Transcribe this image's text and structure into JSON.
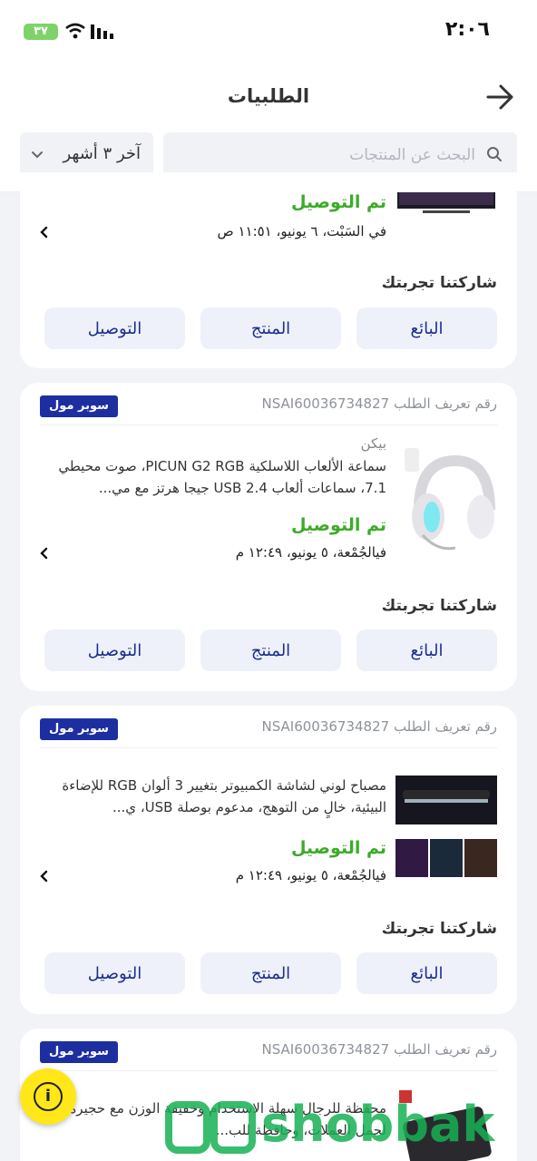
{
  "status_bar": {
    "time": "٢:٠٦",
    "battery": "٣٧"
  },
  "header": {
    "title": "الطلبيات"
  },
  "search": {
    "placeholder": "البحث عن المنتجات"
  },
  "filter": {
    "label": "آخر ٣ أشهر"
  },
  "top_card": {
    "delivered_label": "تم التوصيل",
    "date": "في السَبْت، ٦ يونيو، ١١:٥١ ص",
    "share_label": "شاركتنا تجربتك",
    "buttons": {
      "seller": "البائع",
      "product": "المنتج",
      "delivery": "التوصيل"
    }
  },
  "orders": [
    {
      "order_id": "رقم تعريف الطلب NSAI60036734827",
      "badge": "سوبر مول",
      "seller": "بيكن",
      "product_name": "سماعة الألعاب اللاسلكية PICUN G2 RGB، صوت محيطي 7.1، سماعات ألعاب USB 2.4 جيجا هرتز مع مي...",
      "delivered_label": "تم التوصيل",
      "date": "فيالجُمْعة، ٥ يونيو، ١٢:٤٩ م",
      "share_label": "شاركتنا تجربتك",
      "buttons": {
        "seller": "البائع",
        "product": "المنتج",
        "delivery": "التوصيل"
      }
    },
    {
      "order_id": "رقم تعريف الطلب NSAI60036734827",
      "badge": "سوبر مول",
      "product_name": "مصباح لوني لشاشة الكمبيوتر بتغيير 3 ألوان RGB للإضاءة البيئية، خالٍ من التوهج، مدعوم بوصلة USB، ي...",
      "delivered_label": "تم التوصيل",
      "date": "فيالجُمْعة، ٥ يونيو، ١٢:٤٩ م",
      "share_label": "شاركتنا تجربتك",
      "buttons": {
        "seller": "البائع",
        "product": "المنتج",
        "delivery": "التوصيل"
      }
    },
    {
      "order_id": "رقم تعريف الطلب NSAI60036734827",
      "badge": "سوبر مول",
      "product_name": "محفظة للرجال سهلة الاستخدام وخفيفة الوزن مع حجيرة لحمل العملات، وحافظة للب..."
    }
  ],
  "watermark": {
    "text": "shobbak"
  },
  "colors": {
    "delivered": "#3dab2a",
    "button_text": "#1d2e8e",
    "badge_bg": "#1d2fa0",
    "help_bg": "#ffe71a"
  }
}
